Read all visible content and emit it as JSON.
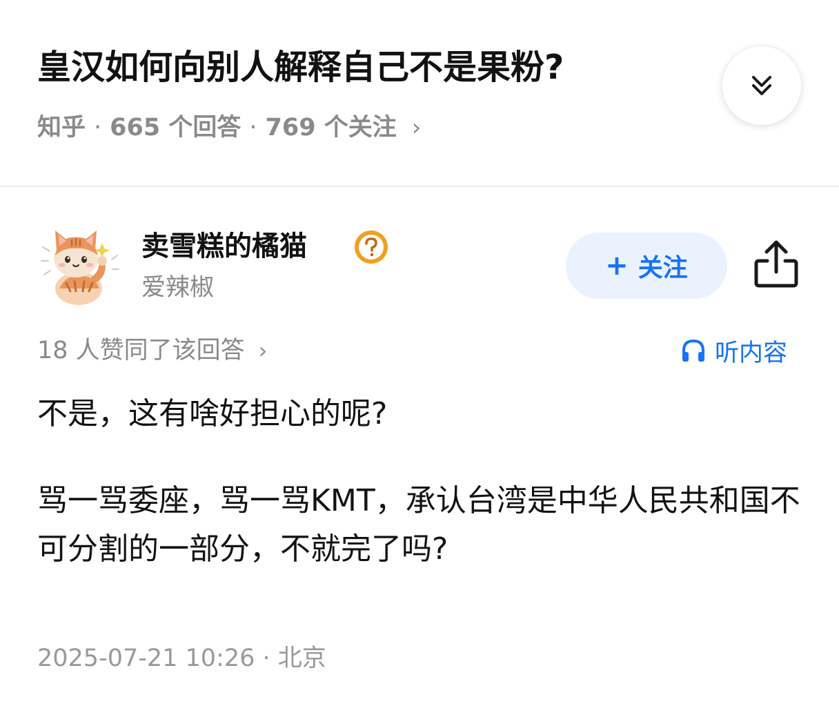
{
  "question": {
    "title": "皇汉如何向别人解释自己不是果粉?",
    "source": "知乎",
    "answers_count": "665 个回答",
    "followers_count": "769 个关注",
    "separator": "·"
  },
  "author": {
    "name": "卖雪糕的橘猫",
    "bio": "爱辣椒",
    "follow_label": "关注",
    "avatar_icon": "cat-avatar-icon",
    "badge_icon": "question-badge-icon"
  },
  "upvote_text": "18 人赞同了该回答",
  "listen_label": "听内容",
  "answer": {
    "paragraphs": [
      "不是，这有啥好担心的呢?",
      "骂一骂委座，骂一骂KMT，承认台湾是中华人民共和国不可分割的一部分，不就完了吗?"
    ]
  },
  "timestamp": "2025-07-21 10:26 · 北京",
  "colors": {
    "accent": "#1772f6",
    "follow_bg": "#eaf2fd",
    "meta_gray": "#8a8a8a",
    "badge_orange": "#f0a020"
  }
}
